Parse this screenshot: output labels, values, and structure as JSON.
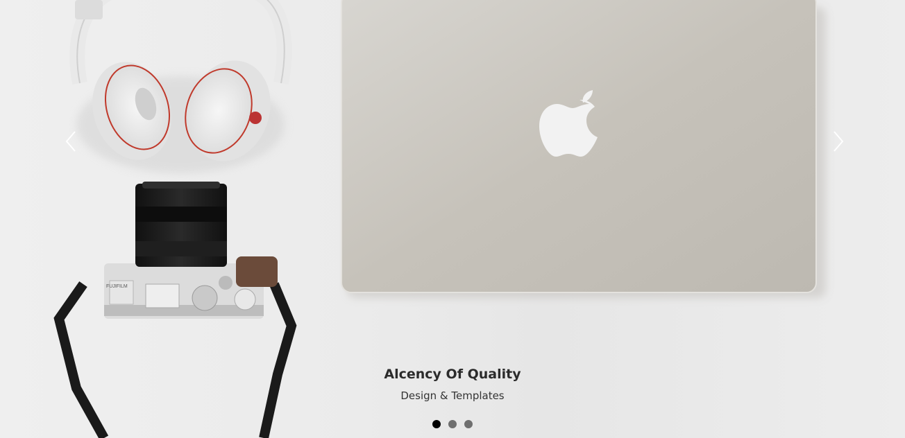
{
  "slide": {
    "title": "Alcency Of Quality",
    "subtitle": "Design & Templates",
    "image_subject": "flat-lay of white headphones, Fujifilm camera and silver laptop",
    "camera_brand_text": "FUJIFILM"
  },
  "controls": {
    "prev_icon": "chevron-left-icon",
    "next_icon": "chevron-right-icon"
  },
  "indicators": [
    {
      "active": true
    },
    {
      "active": false
    },
    {
      "active": false
    }
  ],
  "colors": {
    "background": "#ececec",
    "laptop": "#c9c5bd",
    "indicator_active": "#000000",
    "indicator_inactive": "#6f6f6f"
  }
}
